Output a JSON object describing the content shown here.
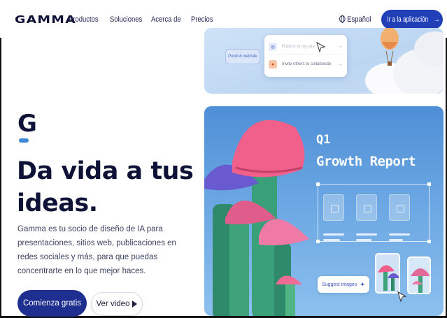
{
  "header": {
    "logo": "GAMMA",
    "nav": [
      "Productos",
      "Soluciones",
      "Acerca de",
      "Precios"
    ],
    "language": "Español",
    "cta_label": "Ir a la aplicación",
    "cta_arrow": "→"
  },
  "hero": {
    "mark": "G",
    "headline": "Da vida a tus ideas.",
    "subtitle": "Gamma es tu socio de diseño de IA para presentaciones, sitios web, publicaciones en redes sociales y más, para que puedas concentrarte en lo que mejor haces.",
    "primary_button": "Comienza gratis",
    "video_button": "Ver video"
  },
  "publish_card": {
    "publish_button": "Publish website",
    "menu_items": [
      {
        "label": "Publish to my site",
        "icon": "globe-icon",
        "arrow": "→"
      },
      {
        "label": "Invite others to collaborate",
        "icon": "user-icon",
        "arrow": "→"
      }
    ]
  },
  "report_card": {
    "title_line1": "Q1",
    "title_line2": "Growth Report",
    "suggest_button": "Suggest images",
    "suggest_icon": "sparkle-icon"
  },
  "colors": {
    "brand_dark": "#0e1236",
    "primary_button": "#1e2f8f",
    "cta": "#2140b8",
    "card_blue": "#4f8fd6"
  }
}
